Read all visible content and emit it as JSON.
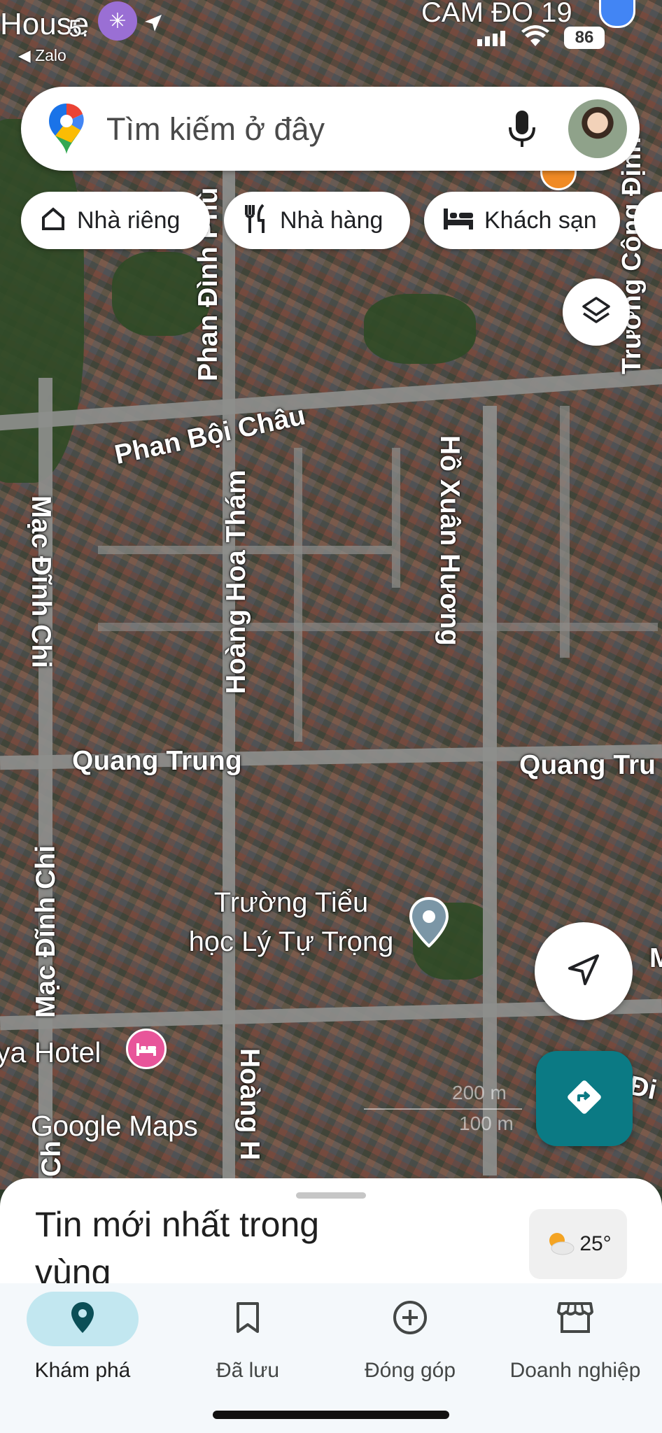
{
  "status_bar": {
    "left_text": "House",
    "left_small": "5.",
    "back_app": "◀ Zalo",
    "right_text": "CAM ĐO 19",
    "battery": "86"
  },
  "search": {
    "placeholder": "Tìm kiếm ở đây"
  },
  "chips": [
    {
      "label": "Nhà riêng",
      "icon": "home-icon"
    },
    {
      "label": "Nhà hàng",
      "icon": "restaurant-icon"
    },
    {
      "label": "Khách sạn",
      "icon": "hotel-icon"
    }
  ],
  "map": {
    "streets": {
      "phan_dinh_phung": "Phan Đình Phù",
      "phan_boi_chau": "Phan Bội Châu",
      "truong_cong_dinh": "Trương Công Định",
      "ho_xuan_huong": "Hồ Xuân Hương",
      "hoang_hoa_tham": "Hoàng Hoa Thám",
      "mac_dinh_chi_1": "Mạc Đĩnh Chi",
      "mac_dinh_chi_2": "Mạc Đĩnh Chi",
      "quang_trung_left": "Quang Trung",
      "quang_trung_right": "Quang Tru",
      "hoang_bottom": "Hoàng H",
      "c_bottom": "Ch",
      "right_m": "M",
      "right_di": "Đi"
    },
    "pois": {
      "school_line1": "Trường Tiểu",
      "school_line2": "học Lý Tự Trọng",
      "hotel": "ya Hotel"
    },
    "watermark": "Google Maps",
    "scale": {
      "top": "200 m",
      "bottom": "100 m"
    }
  },
  "sheet": {
    "title": "Tin mới nhất trong vùng",
    "temperature": "25°"
  },
  "nav": [
    {
      "label": "Khám phá",
      "icon": "explore-pin-icon",
      "active": true
    },
    {
      "label": "Đã lưu",
      "icon": "bookmark-icon",
      "active": false
    },
    {
      "label": "Đóng góp",
      "icon": "add-circle-icon",
      "active": false
    },
    {
      "label": "Doanh nghiệp",
      "icon": "storefront-icon",
      "active": false
    }
  ],
  "colors": {
    "accent": "#0b6b75",
    "nav_active_bg": "#c2e7f0",
    "directions_btn": "#0b7a84"
  }
}
